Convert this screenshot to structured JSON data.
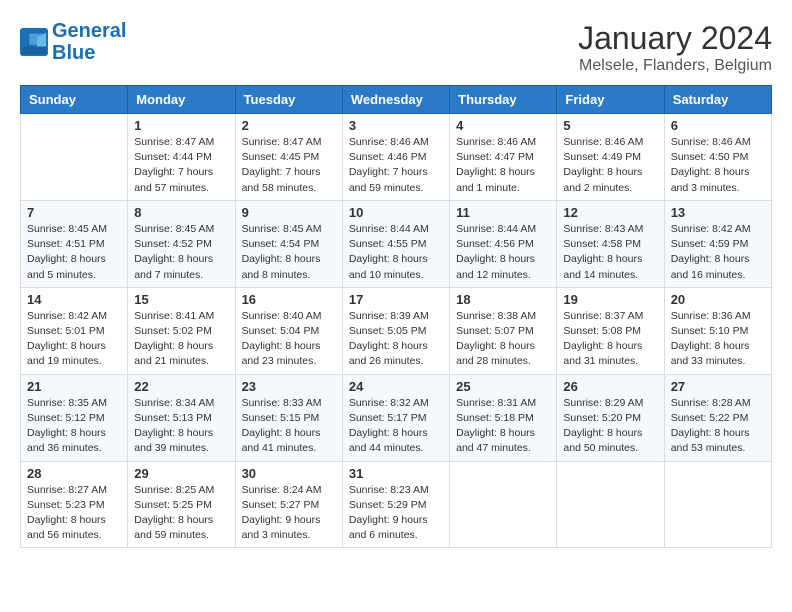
{
  "logo": {
    "line1": "General",
    "line2": "Blue"
  },
  "title": "January 2024",
  "location": "Melsele, Flanders, Belgium",
  "days_of_week": [
    "Sunday",
    "Monday",
    "Tuesday",
    "Wednesday",
    "Thursday",
    "Friday",
    "Saturday"
  ],
  "weeks": [
    [
      {
        "day": "",
        "info": ""
      },
      {
        "day": "1",
        "info": "Sunrise: 8:47 AM\nSunset: 4:44 PM\nDaylight: 7 hours\nand 57 minutes."
      },
      {
        "day": "2",
        "info": "Sunrise: 8:47 AM\nSunset: 4:45 PM\nDaylight: 7 hours\nand 58 minutes."
      },
      {
        "day": "3",
        "info": "Sunrise: 8:46 AM\nSunset: 4:46 PM\nDaylight: 7 hours\nand 59 minutes."
      },
      {
        "day": "4",
        "info": "Sunrise: 8:46 AM\nSunset: 4:47 PM\nDaylight: 8 hours\nand 1 minute."
      },
      {
        "day": "5",
        "info": "Sunrise: 8:46 AM\nSunset: 4:49 PM\nDaylight: 8 hours\nand 2 minutes."
      },
      {
        "day": "6",
        "info": "Sunrise: 8:46 AM\nSunset: 4:50 PM\nDaylight: 8 hours\nand 3 minutes."
      }
    ],
    [
      {
        "day": "7",
        "info": "Sunrise: 8:45 AM\nSunset: 4:51 PM\nDaylight: 8 hours\nand 5 minutes."
      },
      {
        "day": "8",
        "info": "Sunrise: 8:45 AM\nSunset: 4:52 PM\nDaylight: 8 hours\nand 7 minutes."
      },
      {
        "day": "9",
        "info": "Sunrise: 8:45 AM\nSunset: 4:54 PM\nDaylight: 8 hours\nand 8 minutes."
      },
      {
        "day": "10",
        "info": "Sunrise: 8:44 AM\nSunset: 4:55 PM\nDaylight: 8 hours\nand 10 minutes."
      },
      {
        "day": "11",
        "info": "Sunrise: 8:44 AM\nSunset: 4:56 PM\nDaylight: 8 hours\nand 12 minutes."
      },
      {
        "day": "12",
        "info": "Sunrise: 8:43 AM\nSunset: 4:58 PM\nDaylight: 8 hours\nand 14 minutes."
      },
      {
        "day": "13",
        "info": "Sunrise: 8:42 AM\nSunset: 4:59 PM\nDaylight: 8 hours\nand 16 minutes."
      }
    ],
    [
      {
        "day": "14",
        "info": "Sunrise: 8:42 AM\nSunset: 5:01 PM\nDaylight: 8 hours\nand 19 minutes."
      },
      {
        "day": "15",
        "info": "Sunrise: 8:41 AM\nSunset: 5:02 PM\nDaylight: 8 hours\nand 21 minutes."
      },
      {
        "day": "16",
        "info": "Sunrise: 8:40 AM\nSunset: 5:04 PM\nDaylight: 8 hours\nand 23 minutes."
      },
      {
        "day": "17",
        "info": "Sunrise: 8:39 AM\nSunset: 5:05 PM\nDaylight: 8 hours\nand 26 minutes."
      },
      {
        "day": "18",
        "info": "Sunrise: 8:38 AM\nSunset: 5:07 PM\nDaylight: 8 hours\nand 28 minutes."
      },
      {
        "day": "19",
        "info": "Sunrise: 8:37 AM\nSunset: 5:08 PM\nDaylight: 8 hours\nand 31 minutes."
      },
      {
        "day": "20",
        "info": "Sunrise: 8:36 AM\nSunset: 5:10 PM\nDaylight: 8 hours\nand 33 minutes."
      }
    ],
    [
      {
        "day": "21",
        "info": "Sunrise: 8:35 AM\nSunset: 5:12 PM\nDaylight: 8 hours\nand 36 minutes."
      },
      {
        "day": "22",
        "info": "Sunrise: 8:34 AM\nSunset: 5:13 PM\nDaylight: 8 hours\nand 39 minutes."
      },
      {
        "day": "23",
        "info": "Sunrise: 8:33 AM\nSunset: 5:15 PM\nDaylight: 8 hours\nand 41 minutes."
      },
      {
        "day": "24",
        "info": "Sunrise: 8:32 AM\nSunset: 5:17 PM\nDaylight: 8 hours\nand 44 minutes."
      },
      {
        "day": "25",
        "info": "Sunrise: 8:31 AM\nSunset: 5:18 PM\nDaylight: 8 hours\nand 47 minutes."
      },
      {
        "day": "26",
        "info": "Sunrise: 8:29 AM\nSunset: 5:20 PM\nDaylight: 8 hours\nand 50 minutes."
      },
      {
        "day": "27",
        "info": "Sunrise: 8:28 AM\nSunset: 5:22 PM\nDaylight: 8 hours\nand 53 minutes."
      }
    ],
    [
      {
        "day": "28",
        "info": "Sunrise: 8:27 AM\nSunset: 5:23 PM\nDaylight: 8 hours\nand 56 minutes."
      },
      {
        "day": "29",
        "info": "Sunrise: 8:25 AM\nSunset: 5:25 PM\nDaylight: 8 hours\nand 59 minutes."
      },
      {
        "day": "30",
        "info": "Sunrise: 8:24 AM\nSunset: 5:27 PM\nDaylight: 9 hours\nand 3 minutes."
      },
      {
        "day": "31",
        "info": "Sunrise: 8:23 AM\nSunset: 5:29 PM\nDaylight: 9 hours\nand 6 minutes."
      },
      {
        "day": "",
        "info": ""
      },
      {
        "day": "",
        "info": ""
      },
      {
        "day": "",
        "info": ""
      }
    ]
  ]
}
